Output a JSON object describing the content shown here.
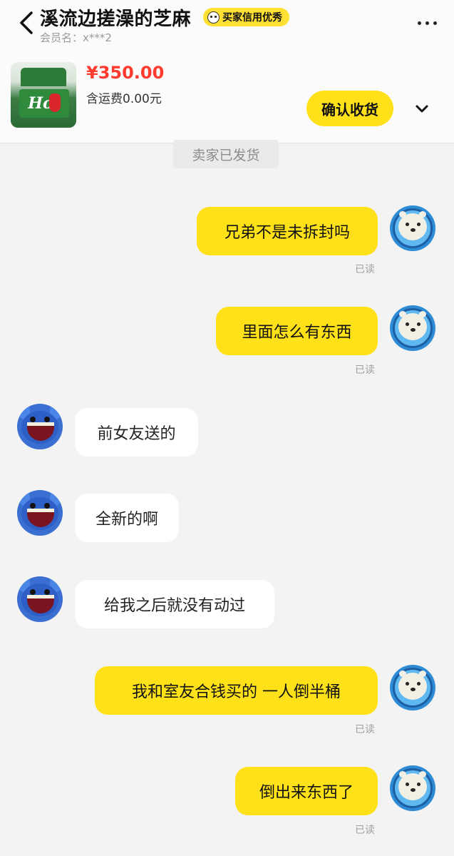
{
  "header": {
    "title": "溪流边搓澡的芝麻",
    "badge": "买家信用优秀",
    "member": "会员名：x***2",
    "product": {
      "thumb_text": "Hot",
      "price": "¥350.00",
      "shipping": "含运费0.00元",
      "confirm_label": "确认收货"
    }
  },
  "chat": {
    "system_message": "卖家已发货",
    "messages": [
      {
        "from": "me",
        "text": "兄弟不是未拆封吗",
        "status": "已读"
      },
      {
        "from": "me",
        "text": "里面怎么有东西",
        "status": "已读"
      },
      {
        "from": "them",
        "text": "前女友送的"
      },
      {
        "from": "them",
        "text": "全新的啊"
      },
      {
        "from": "them",
        "text": "给我之后就没有动过"
      },
      {
        "from": "me",
        "text": "我和室友合钱买的 一人倒半桶",
        "status": "已读"
      },
      {
        "from": "me",
        "text": "倒出来东西了",
        "status": "已读"
      }
    ]
  },
  "colors": {
    "accent_yellow": "#ffe11a",
    "price_red": "#ff3b30",
    "background": "#f3f3f3"
  }
}
